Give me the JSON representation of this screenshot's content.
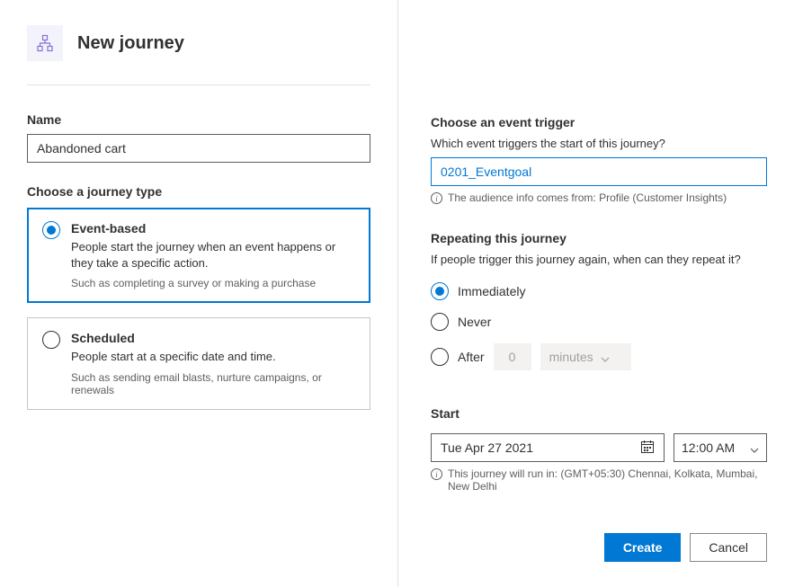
{
  "header": {
    "title": "New journey"
  },
  "left": {
    "name_label": "Name",
    "name_value": "Abandoned cart",
    "journey_type_label": "Choose a journey type",
    "types": {
      "event": {
        "title": "Event-based",
        "desc": "People start the journey when an event happens or they take a specific action.",
        "example": "Such as completing a survey or making a purchase"
      },
      "scheduled": {
        "title": "Scheduled",
        "desc": "People start at a specific date and time.",
        "example": "Such as sending email blasts, nurture campaigns, or renewals"
      }
    }
  },
  "right": {
    "trigger_heading": "Choose an event trigger",
    "trigger_question": "Which event triggers the start of this journey?",
    "trigger_value": "0201_Eventgoal",
    "audience_info": "The audience info comes from: Profile (Customer Insights)",
    "repeat_heading": "Repeating this journey",
    "repeat_question": "If people trigger this journey again, when can they repeat it?",
    "repeat_options": {
      "immediately": "Immediately",
      "never": "Never",
      "after": "After",
      "after_value": "0",
      "after_unit": "minutes"
    },
    "start_heading": "Start",
    "start_date": "Tue Apr 27 2021",
    "start_time": "12:00 AM",
    "timezone_info": "This journey will run in: (GMT+05:30) Chennai, Kolkata, Mumbai, New Delhi"
  },
  "footer": {
    "create": "Create",
    "cancel": "Cancel"
  }
}
